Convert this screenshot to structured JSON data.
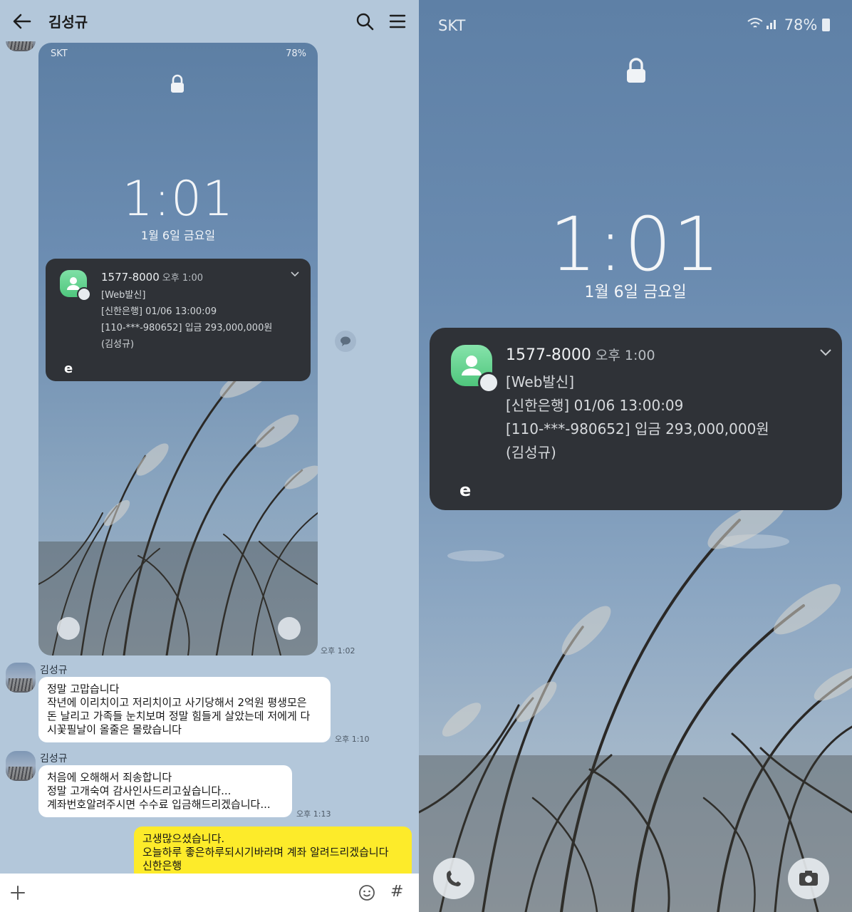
{
  "chat": {
    "title": "김성규",
    "screenshot": {
      "carrier": "SKT",
      "status": "78%",
      "time": "1:01",
      "date": "1월 6일 금요일",
      "notification": {
        "sender": "1577-8000",
        "time": "오후 1:00",
        "lines": [
          "[Web발신]",
          "[신한은행] 01/06 13:00:09",
          "[110-***-980652] 입금 293,000,000원",
          "(김성규)"
        ],
        "app_initial": "e"
      },
      "sent_time": "오후 1:02"
    },
    "messages": [
      {
        "sender": "김성규",
        "lines": [
          "정말 고맙습니다",
          "작년에 이리치이고 저리치이고 사기당해서 2억원 평생모은",
          "돈 날리고 가족들 눈치보며 정말 힘들게 살았는데 저에게 다",
          "시꽃필날이 올줄은 몰랐습니다"
        ],
        "time": "오후 1:10"
      },
      {
        "sender": "김성규",
        "lines": [
          "처음에 오해해서 죄송합니다",
          "정말 고개숙여 감사인사드리고싶습니다...",
          "계좌번호알려주시면 수수료 입금해드리겠습니다..."
        ],
        "time": "오후 1:13"
      },
      {
        "sender": "me",
        "lines": [
          "고생많으셨습니다.",
          "오늘하루 좋은하루되시기바라며 계좌 알려드리겠습니다",
          "신한은행"
        ]
      }
    ],
    "input": {
      "hash": "#"
    }
  },
  "lockscreen": {
    "carrier": "SKT",
    "battery": "78%",
    "time": "1:01",
    "date": "1월 6일 금요일",
    "notification": {
      "sender": "1577-8000",
      "time": "오후 1:00",
      "lines": [
        "[Web발신]",
        "[신한은행] 01/06 13:00:09",
        "[110-***-980652] 입금 293,000,000원",
        "(김성규)"
      ],
      "app_initial": "e"
    }
  },
  "colors": {
    "chat_bg": "#b3c7da",
    "my_bubble": "#fdeb2a",
    "notification_bg": "#2f3237",
    "messages_icon": "#5fd08d"
  },
  "icons": [
    "back-arrow-icon",
    "search-icon",
    "menu-icon",
    "lock-icon",
    "messages-app-icon",
    "chevron-down-icon",
    "phone-icon",
    "camera-icon",
    "plus-icon",
    "emoji-icon",
    "share-icon"
  ]
}
